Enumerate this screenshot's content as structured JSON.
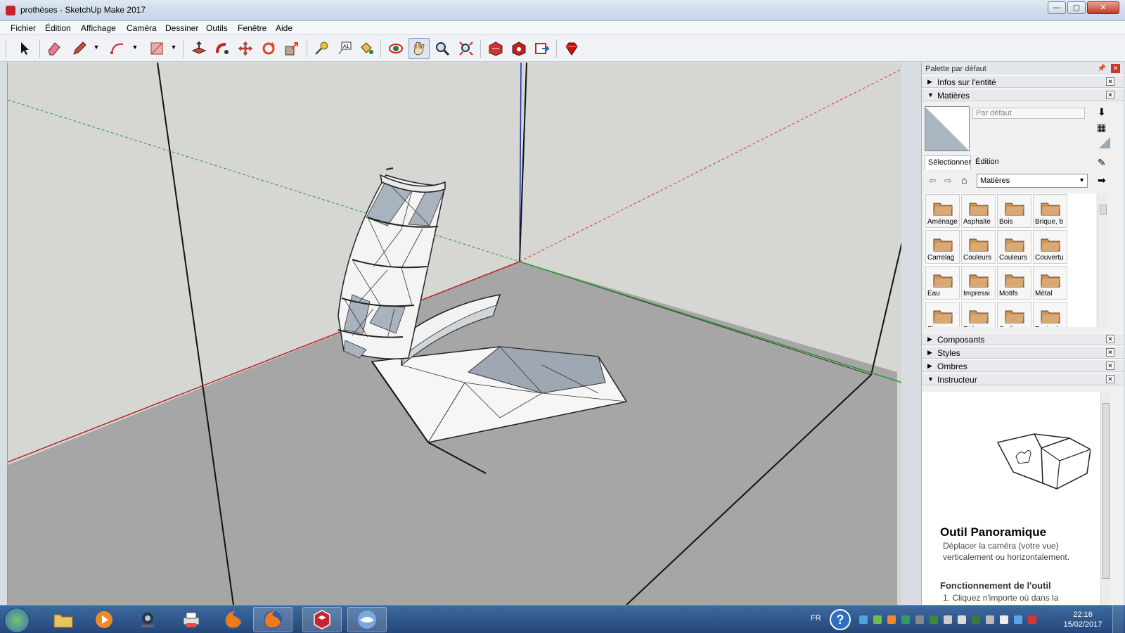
{
  "window": {
    "title": "prothèses - SketchUp Make 2017",
    "controls": [
      "minimize",
      "maximize",
      "close"
    ]
  },
  "menu": [
    "Fichier",
    "Édition",
    "Affichage",
    "Caméra",
    "Dessiner",
    "Outils",
    "Fenêtre",
    "Aide"
  ],
  "toolbar": {
    "tools": [
      "select-icon",
      "eraser-icon",
      "pencil-icon",
      "arc-icon",
      "rectangle-icon",
      "push-pull-icon",
      "follow-me-icon",
      "move-icon",
      "rotate-icon",
      "scale-icon",
      "tape-measure-icon",
      "text-icon",
      "paint-bucket-icon",
      "orbit-icon",
      "pan-icon",
      "zoom-icon",
      "zoom-extents-icon",
      "warehouse-icon",
      "extension-warehouse-icon",
      "send-to-layout-icon",
      "ruby-icon"
    ],
    "active_tool": "pan-icon"
  },
  "tray": {
    "title": "Palette par défaut",
    "sections": {
      "entity_info": "Infos sur l'entité",
      "materials": "Matières",
      "components": "Composants",
      "styles": "Styles",
      "shadows": "Ombres",
      "instructor": "Instructeur"
    },
    "material_name": "Par défaut",
    "tabs": [
      "Sélectionner",
      "Édition"
    ],
    "library": "Matières",
    "folders": [
      "Aménage",
      "Asphalte",
      "Bois",
      "Brique, b",
      "Carrelag",
      "Couleurs",
      "Couleurs",
      "Couvertu",
      "Eau",
      "Impressi",
      "Motifs",
      "Métal",
      "Pierre",
      "Rideaux",
      "Surfaces",
      "Tapis, tis"
    ],
    "instructor": {
      "heading": "Outil Panoramique",
      "description": "Déplacer la caméra (votre vue) verticalement ou horizontalement.",
      "subheading": "Fonctionnement de l'outil",
      "step1": "1. Cliquez n'importe où dans la"
    }
  },
  "taskbar": {
    "apps": [
      "explorer-icon",
      "media-player-icon",
      "webcam-icon",
      "printer-icon",
      "firefox-icon",
      "firefox-icon",
      "sketchup-icon",
      "thunderbird-icon"
    ],
    "language": "FR",
    "time": "22:16",
    "date": "15/02/2017"
  },
  "colors": {
    "accent": "#2e6fc0",
    "viewport_sky": "#d6d6d3",
    "viewport_ground": "#a6a6a6"
  }
}
